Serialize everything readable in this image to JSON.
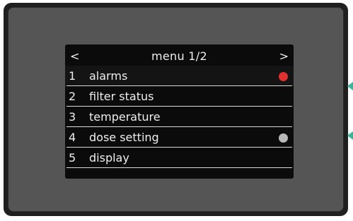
{
  "menu": {
    "prev": "<",
    "title": "menu  1/2",
    "next": ">",
    "items": [
      {
        "number": "1",
        "label": "alarms",
        "indicator": "alarm-dot",
        "indicator_color": "#e03030"
      },
      {
        "number": "2",
        "label": "filter status"
      },
      {
        "number": "3",
        "label": "temperature"
      },
      {
        "number": "4",
        "label": "dose setting",
        "indicator": "status-dot",
        "indicator_color": "#b8b8b8"
      },
      {
        "number": "5",
        "label": "display"
      }
    ]
  },
  "side_markers": {
    "color": "#3fb39a",
    "icons": [
      "pointer-left-icon",
      "pointer-left-icon"
    ]
  }
}
